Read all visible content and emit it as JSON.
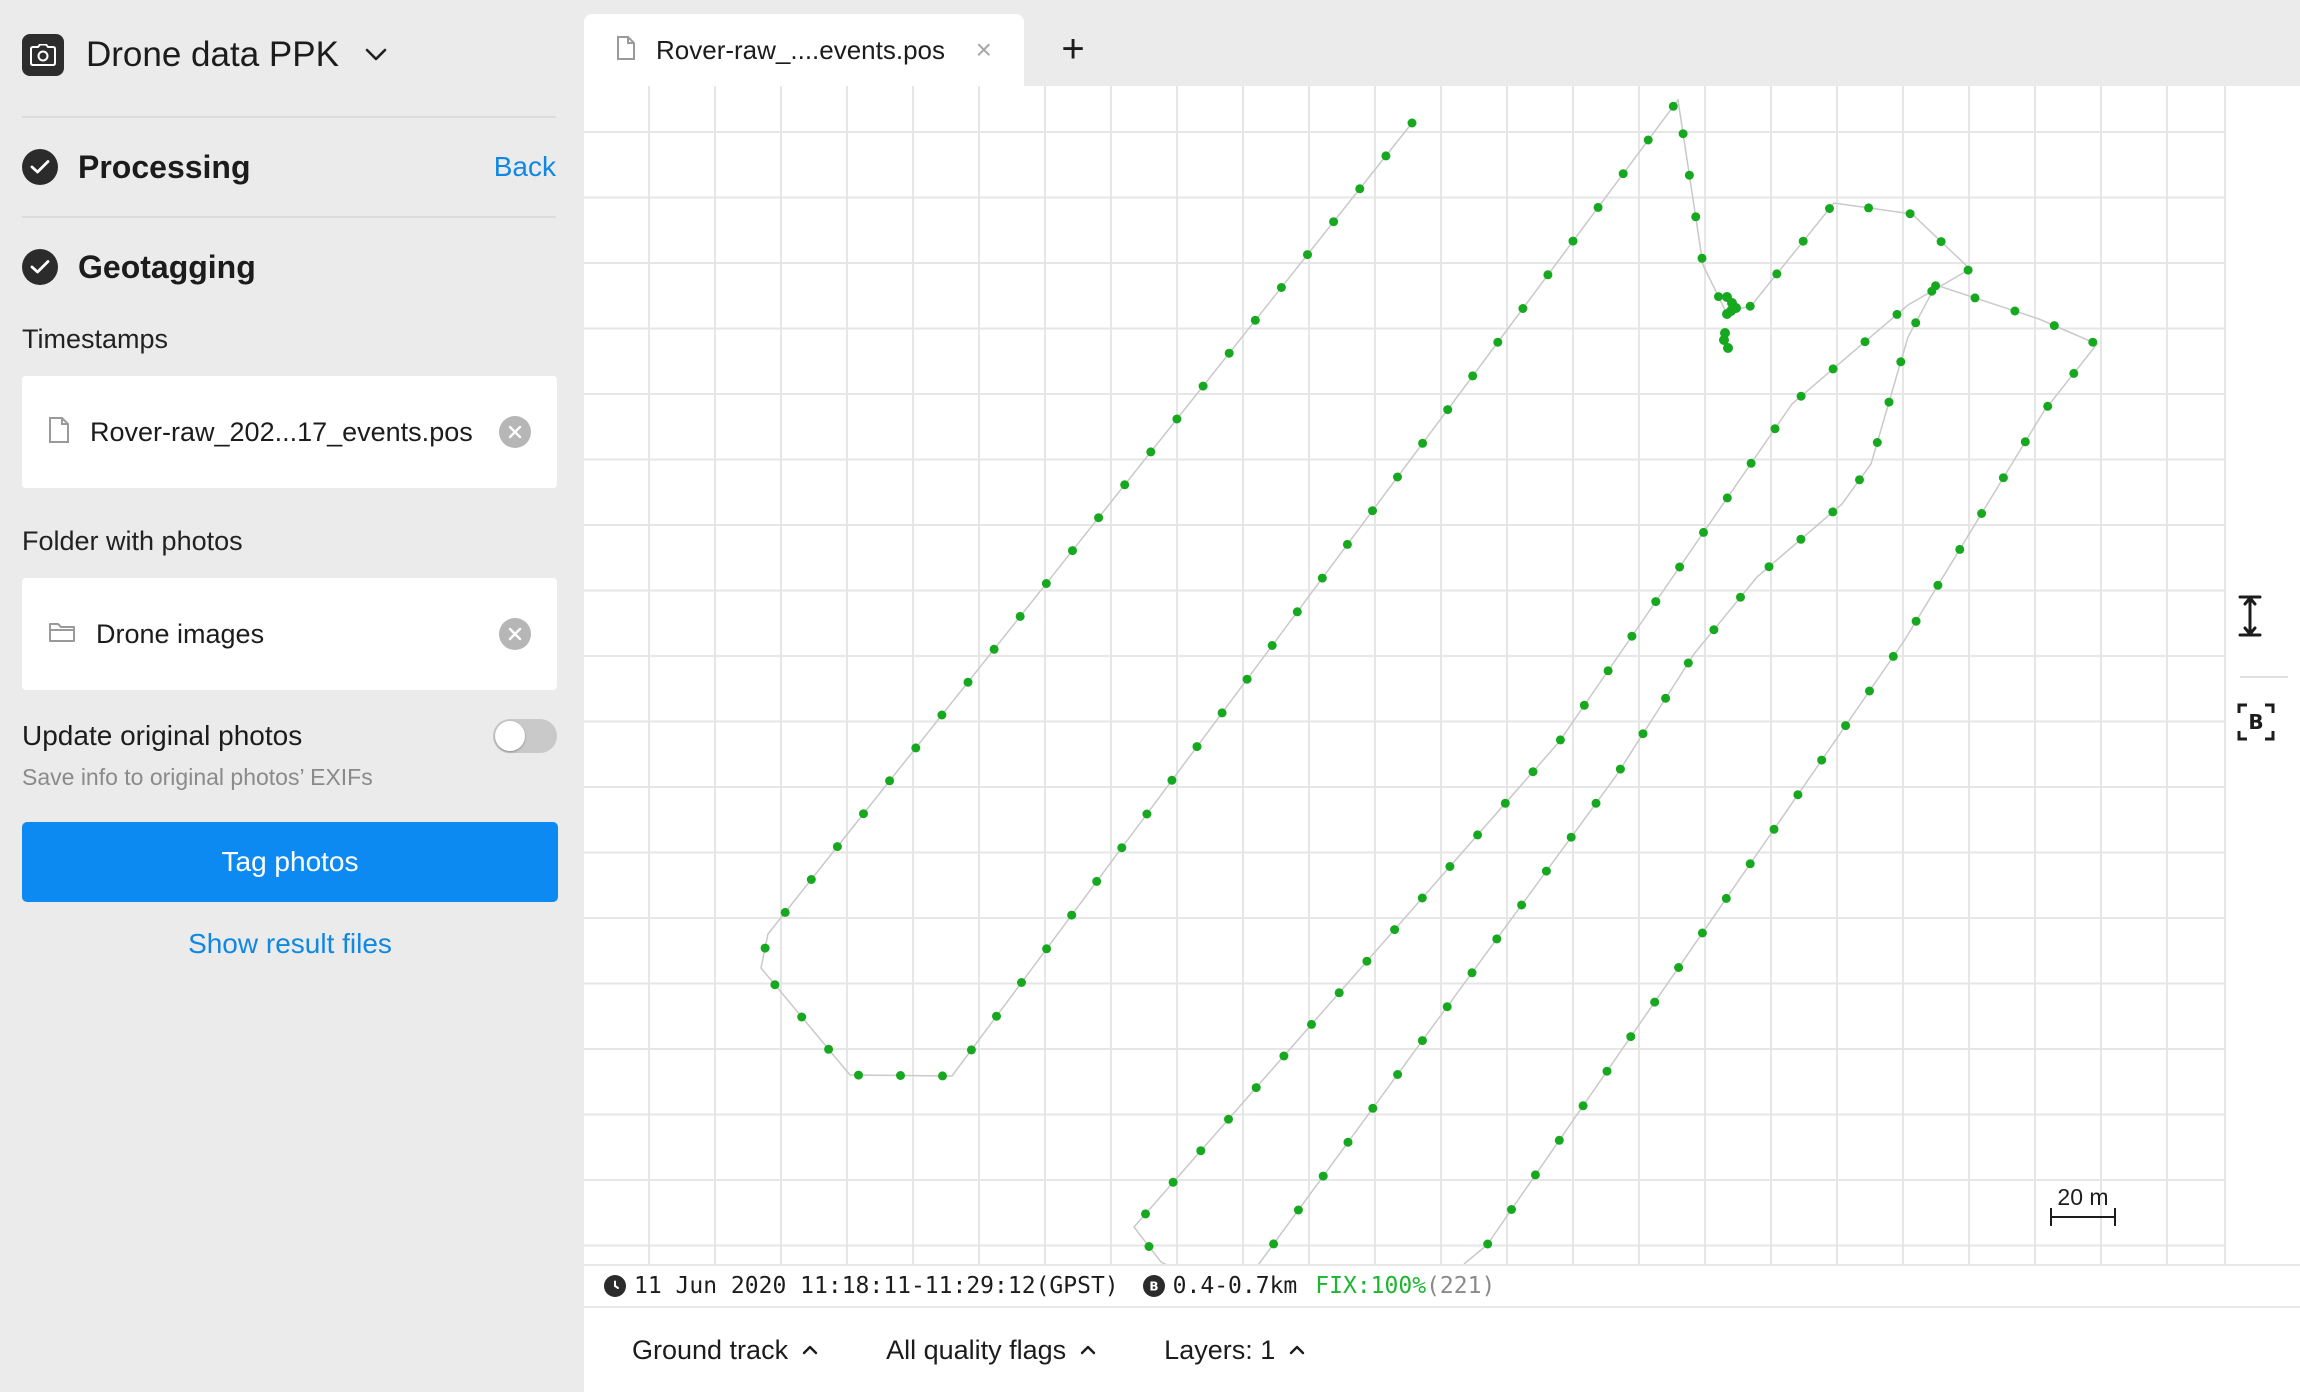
{
  "project": {
    "title": "Drone data PPK",
    "camera_icon": "camera-icon",
    "dropdown_icon": "chevron-down-icon"
  },
  "steps": {
    "processing": {
      "label": "Processing",
      "back_label": "Back"
    },
    "geotagging": {
      "label": "Geotagging"
    }
  },
  "timestamps": {
    "label": "Timestamps",
    "file_name": "Rover-raw_202...17_events.pos"
  },
  "folder": {
    "label": "Folder with photos",
    "name": "Drone images"
  },
  "update_original": {
    "label": "Update original photos",
    "hint": "Save info to original photos’ EXIFs",
    "enabled": false
  },
  "actions": {
    "tag_label": "Tag photos",
    "show_results_label": "Show result files"
  },
  "tabs": [
    {
      "label": "Rover-raw_....events.pos",
      "close": "×"
    }
  ],
  "add_tab": "+",
  "map": {
    "scale_label": "20 m",
    "track_color": "#16a81e",
    "line_color": "#c9c9c9",
    "grid_color": "#e6e6e6"
  },
  "status": {
    "date_time": "11 Jun 2020 11:18:11-11:29:12(GPST)",
    "baseline": "0.4-0.7km",
    "fix": "FIX:100%",
    "fix_count": "(221)"
  },
  "bottom": {
    "ground_track": "Ground track",
    "quality_flags": "All quality flags",
    "layers": "Layers: 1"
  }
}
